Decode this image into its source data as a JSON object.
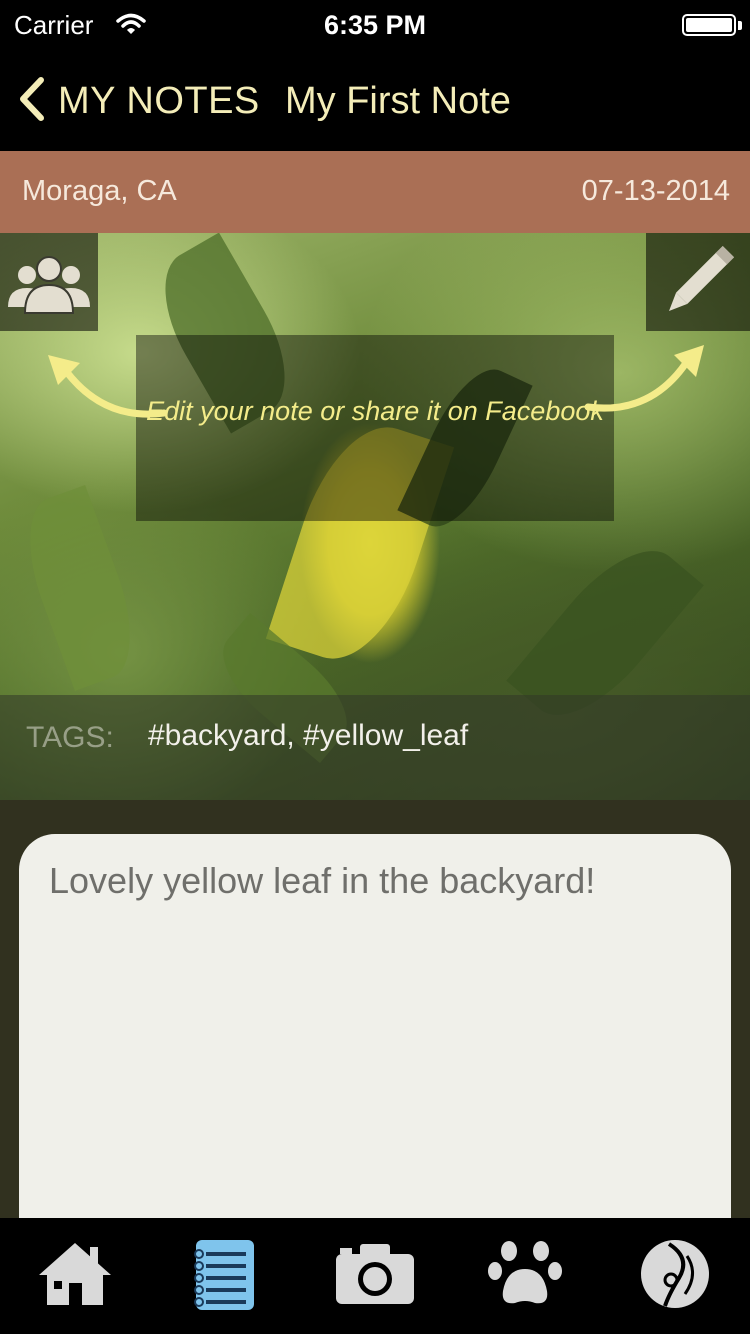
{
  "status": {
    "carrier": "Carrier",
    "time": "6:35 PM"
  },
  "nav": {
    "back_label": "MY NOTES",
    "title": "My First Note"
  },
  "note": {
    "location": "Moraga, CA",
    "date": "07-13-2014",
    "tip": "Edit your note or share it on Facebook",
    "tags_label": "TAGS:",
    "tags": "#backyard, #yellow_leaf",
    "body": "Lovely yellow leaf in the backyard!"
  },
  "tabs": [
    {
      "icon": "home-icon",
      "active": false
    },
    {
      "icon": "notebook-icon",
      "active": true
    },
    {
      "icon": "camera-icon",
      "active": false
    },
    {
      "icon": "paw-icon",
      "active": false
    },
    {
      "icon": "compass-icon",
      "active": false
    }
  ],
  "colors": {
    "nav_text": "#f4edb8",
    "location_bar": "#aa6f55",
    "tip_text": "#f4ec8a",
    "active_tab": "#7fc4ec",
    "inactive_tab": "#d9d9d9"
  }
}
